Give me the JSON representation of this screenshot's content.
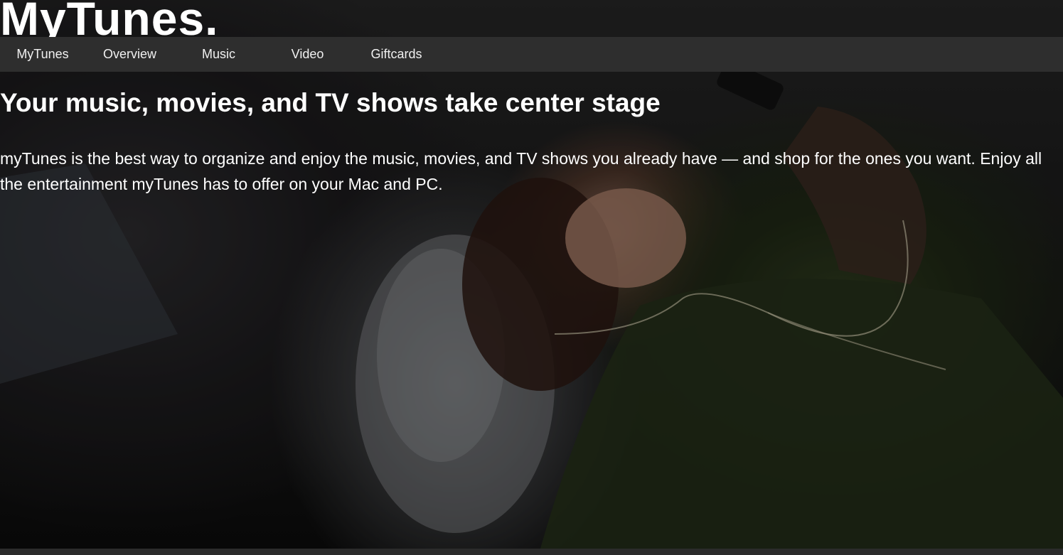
{
  "brand": {
    "title": "MyTunes."
  },
  "nav": {
    "items": [
      {
        "label": "MyTunes"
      },
      {
        "label": "Overview"
      },
      {
        "label": "Music"
      },
      {
        "label": "Video"
      },
      {
        "label": "Giftcards"
      }
    ]
  },
  "hero": {
    "headline": "Your music, movies, and TV shows take center stage",
    "paragraph": "myTunes is the best way to organize and enjoy the music, movies, and TV shows you already have — and shop for the ones you want. Enjoy all the entertainment myTunes has to offer on your Mac and PC."
  },
  "colors": {
    "nav_background": "#2e2e2e",
    "text": "#ffffff",
    "page_background": "#141414"
  }
}
